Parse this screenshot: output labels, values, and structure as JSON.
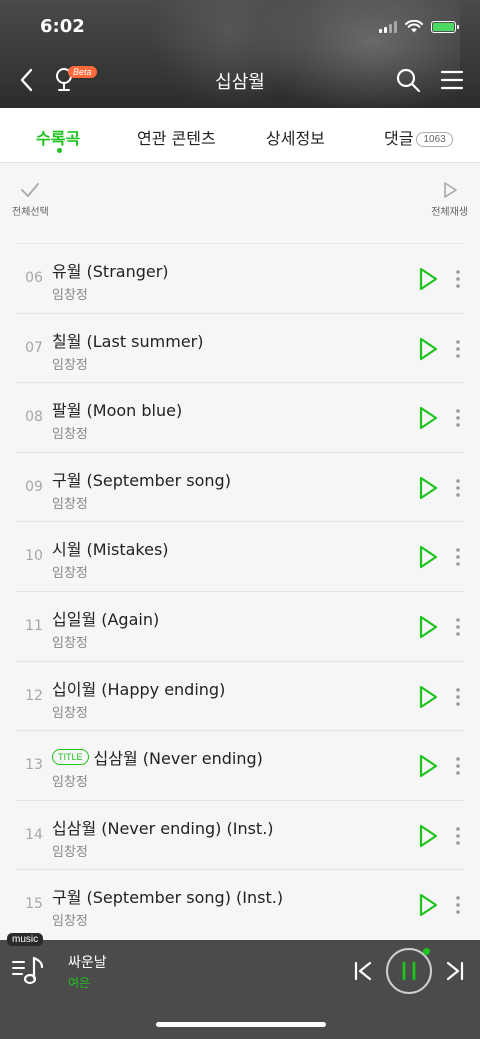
{
  "status_bar": {
    "time": "6:02"
  },
  "nav": {
    "title": "십삼월",
    "beta_label": "Beta"
  },
  "tabs": [
    {
      "label": "수록곡",
      "active": true
    },
    {
      "label": "연관 콘텐츠"
    },
    {
      "label": "상세정보"
    },
    {
      "label": "댓글",
      "count": "1063"
    }
  ],
  "toolbar": {
    "select_all": "전체선택",
    "play_all": "전체재생"
  },
  "songs": [
    {
      "num": "06",
      "title": "유월 (Stranger)",
      "artist": "임창정"
    },
    {
      "num": "07",
      "title": "칠월 (Last summer)",
      "artist": "임창정"
    },
    {
      "num": "08",
      "title": "팔월 (Moon blue)",
      "artist": "임창정"
    },
    {
      "num": "09",
      "title": "구월 (September song)",
      "artist": "임창정"
    },
    {
      "num": "10",
      "title": "시월 (Mistakes)",
      "artist": "임창정"
    },
    {
      "num": "11",
      "title": "십일월 (Again)",
      "artist": "임창정"
    },
    {
      "num": "12",
      "title": "십이월 (Happy ending)",
      "artist": "임창정"
    },
    {
      "num": "13",
      "title": "십삼월 (Never ending)",
      "artist": "임창정",
      "tag": "TITLE"
    },
    {
      "num": "14",
      "title": "십삼월 (Never ending) (Inst.)",
      "artist": "임창정"
    },
    {
      "num": "15",
      "title": "구월 (September song) (Inst.)",
      "artist": "임창정"
    }
  ],
  "player": {
    "badge": "music",
    "title": "싸운날",
    "artist": "여은"
  },
  "colors": {
    "accent": "#1ec31e",
    "header_bg": "#3a3a3a",
    "player_bg": "#4b4b4b"
  }
}
